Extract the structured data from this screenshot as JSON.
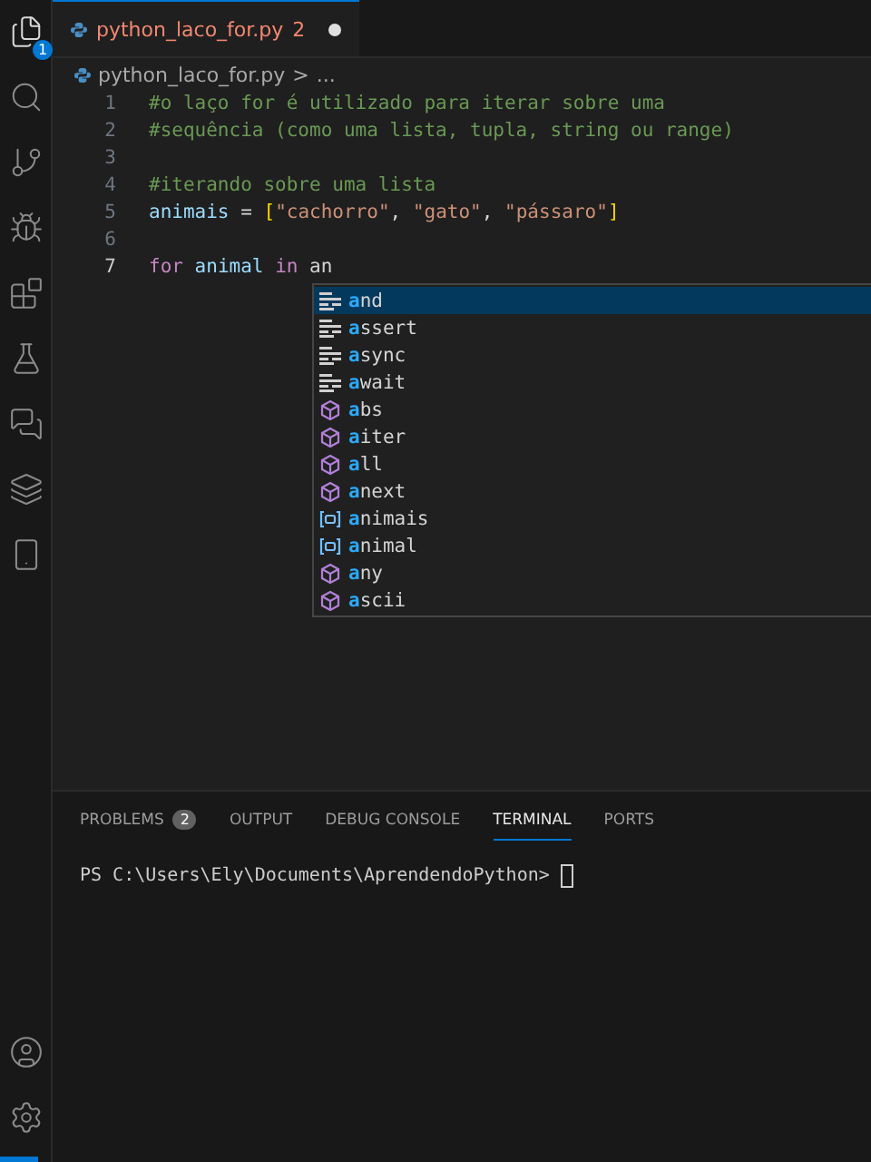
{
  "activity_bar": {
    "items": [
      {
        "kind": "files",
        "selected": true,
        "badge": "1"
      },
      {
        "kind": "search",
        "selected": false
      },
      {
        "kind": "source-control",
        "selected": false
      },
      {
        "kind": "run-debug",
        "selected": false
      },
      {
        "kind": "extensions",
        "selected": false
      },
      {
        "kind": "testing",
        "selected": false
      },
      {
        "kind": "chat",
        "selected": false
      },
      {
        "kind": "layers",
        "selected": false
      },
      {
        "kind": "device",
        "selected": false
      }
    ],
    "bottom": [
      {
        "kind": "account"
      },
      {
        "kind": "settings"
      }
    ]
  },
  "tabs": [
    {
      "label": "python_laco_for.py",
      "problems": "2",
      "modified": true,
      "selected": true
    }
  ],
  "breadcrumb": {
    "file": "python_laco_for.py",
    "separator": ">",
    "rest": "..."
  },
  "code": [
    {
      "number": "1",
      "tokens": [
        {
          "kind": "comment",
          "text": "#o laço for é utilizado para iterar sobre uma"
        }
      ]
    },
    {
      "number": "2",
      "tokens": [
        {
          "kind": "comment",
          "text": "#sequência (como uma lista, tupla, string ou range)"
        }
      ]
    },
    {
      "number": "3"
    },
    {
      "number": "4",
      "tokens": [
        {
          "kind": "comment",
          "text": "#iterando sobre uma lista"
        }
      ]
    },
    {
      "number": "5",
      "tokens": [
        {
          "kind": "variable",
          "text": "animais"
        },
        {
          "kind": "plain",
          "text": " = "
        },
        {
          "kind": "bracket",
          "text": "["
        },
        {
          "kind": "string",
          "text": "\"cachorro\""
        },
        {
          "kind": "plain",
          "text": ", "
        },
        {
          "kind": "string",
          "text": "\"gato\""
        },
        {
          "kind": "plain",
          "text": ", "
        },
        {
          "kind": "string",
          "text": "\"pássaro\""
        },
        {
          "kind": "bracket",
          "text": "]"
        }
      ]
    },
    {
      "number": "6"
    },
    {
      "number": "7",
      "current": true,
      "tokens": [
        {
          "kind": "keyword",
          "text": "for "
        },
        {
          "kind": "variable",
          "text": "animal "
        },
        {
          "kind": "keyword",
          "text": "in "
        },
        {
          "kind": "plain",
          "text": "an"
        }
      ]
    }
  ],
  "suggestions": [
    {
      "kind": "keyword",
      "label": "and",
      "selected": true
    },
    {
      "kind": "keyword",
      "label": "assert",
      "selected": false
    },
    {
      "kind": "keyword",
      "label": "async",
      "selected": false
    },
    {
      "kind": "keyword",
      "label": "await",
      "selected": false
    },
    {
      "kind": "function",
      "label": "abs",
      "selected": false
    },
    {
      "kind": "function",
      "label": "aiter",
      "selected": false
    },
    {
      "kind": "function",
      "label": "all",
      "selected": false
    },
    {
      "kind": "function",
      "label": "anext",
      "selected": false
    },
    {
      "kind": "variable",
      "label": "animais",
      "selected": false
    },
    {
      "kind": "variable",
      "label": "animal",
      "selected": false
    },
    {
      "kind": "function",
      "label": "any",
      "selected": false
    },
    {
      "kind": "function",
      "label": "ascii",
      "selected": false
    }
  ],
  "panel": {
    "tabs": [
      {
        "label": "PROBLEMS",
        "badge": "2",
        "selected": false
      },
      {
        "label": "OUTPUT",
        "selected": false
      },
      {
        "label": "DEBUG CONSOLE",
        "selected": false
      },
      {
        "label": "TERMINAL",
        "selected": true
      },
      {
        "label": "PORTS",
        "selected": false
      }
    ],
    "terminal": {
      "prompt": "PS C:\\Users\\Ely\\Documents\\AprendendoPython>"
    }
  }
}
